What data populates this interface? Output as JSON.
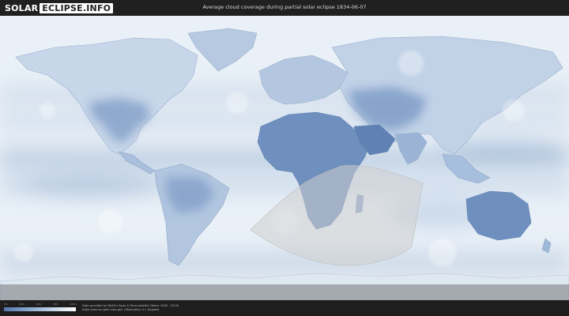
{
  "header": {
    "logo_left": "SOLAR",
    "logo_right": "ECLIPSE.INFO",
    "title": "Average cloud coverage during partial solar eclipse 1834-06-07"
  },
  "map": {
    "ocean_color": "#e9f0f7",
    "cloud_dark_color": "#5a7db0",
    "eclipse_shade_color": "#cfcfcf"
  },
  "legend": {
    "ticks": [
      "0%",
      "25%",
      "50%",
      "75%",
      "100%"
    ]
  },
  "footer": {
    "credit_line1": "Data provided by NASA's Aqua & Terra satellite (Years: 2000 - 2019)",
    "credit_line2": "https://neo.sci.gsfc.nasa.gov  |  Resolution: 0.1 degrees"
  }
}
